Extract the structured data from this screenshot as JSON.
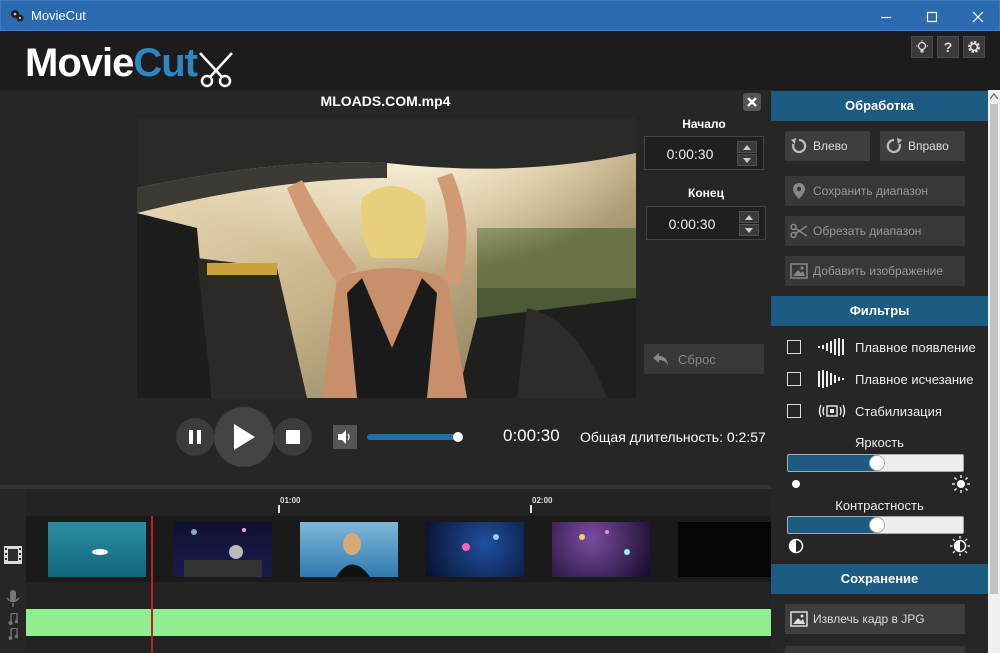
{
  "window": {
    "title": "MovieCut"
  },
  "header": {
    "logo_main": "Movie",
    "logo_accent": "Cut",
    "help_label": "?"
  },
  "player": {
    "file_name": "MLOADS.COM.mp4",
    "start_label": "Начало",
    "start_value": "0:00:30",
    "end_label": "Конец",
    "end_value": "0:00:30",
    "reset_label": "Сброс",
    "current_time": "0:00:30",
    "total_duration": "Общая длительность: 0:2:57",
    "volume_level": 0.95
  },
  "timeline": {
    "ticks": [
      "01:00",
      "02:00"
    ]
  },
  "processing": {
    "heading": "Обработка",
    "rotate_left": "Влево",
    "rotate_right": "Вправо",
    "save_range": "Сохранить диапазон",
    "cut_range": "Обрезать диапазон",
    "add_image": "Добавить изображение"
  },
  "filters": {
    "heading": "Фильтры",
    "items": [
      {
        "label": "Плавное появление",
        "checked": false,
        "icon": "fade-in-icon"
      },
      {
        "label": "Плавное исчезание",
        "checked": false,
        "icon": "fade-out-icon"
      },
      {
        "label": "Стабилизация",
        "checked": false,
        "icon": "stabilize-icon"
      }
    ],
    "brightness_label": "Яркость",
    "brightness_value": 0.5,
    "contrast_label": "Контрастность",
    "contrast_value": 0.5
  },
  "saving": {
    "heading": "Сохранение",
    "extract_frame": "Извлечь кадр в JPG"
  },
  "colors": {
    "accent": "#1c5b82",
    "titlebar": "#2d6bb0",
    "audio_track": "#90ee90",
    "playhead": "#c0211f"
  }
}
